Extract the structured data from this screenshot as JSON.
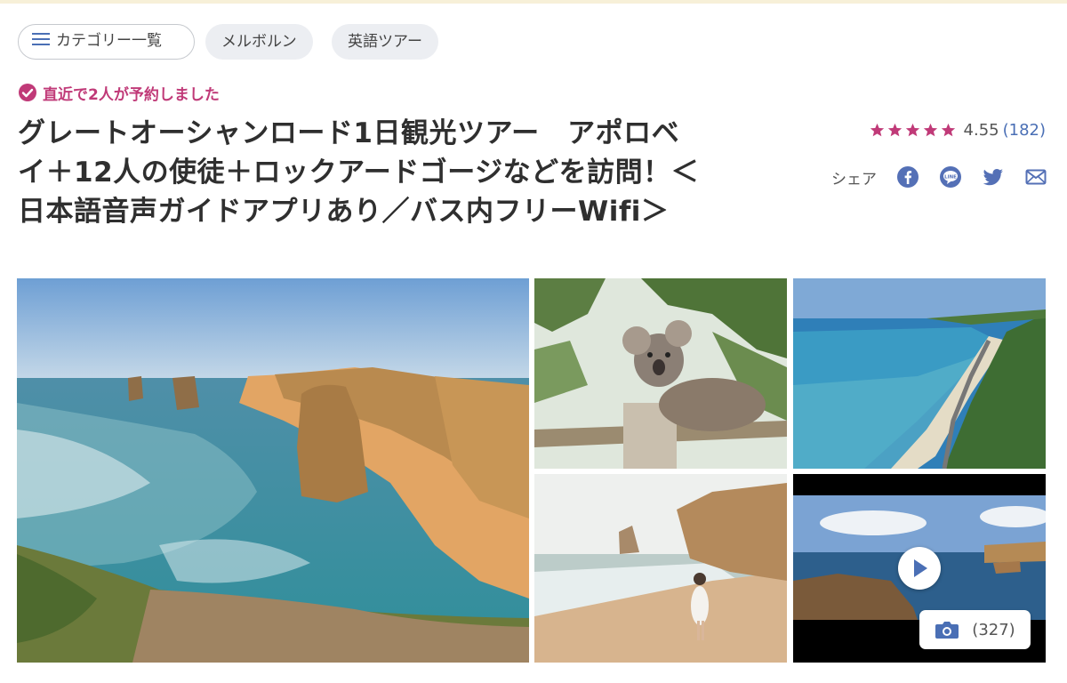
{
  "chips": {
    "category_menu": "カテゴリー一覧",
    "tag_1": "メルボルン",
    "tag_2": "英語ツアー"
  },
  "booking_notice": "直近で2人が予約しました",
  "tour_title": "グレートオーシャンロード1日観光ツアー　アポロベイ＋12人の使徒＋ロックアードゴージなどを訪問！＜日本語音声ガイドアプリあり／バス内フリーWifi＞",
  "rating": {
    "stars": 5,
    "score": "4.55",
    "count": "(182)"
  },
  "share": {
    "label": "シェア",
    "icons": [
      "facebook-icon",
      "line-icon",
      "twitter-icon",
      "mail-icon"
    ]
  },
  "gallery": {
    "photo_count": "(327)",
    "photos": [
      "twelve-apostles-coast",
      "koala-in-tree",
      "aerial-coastline",
      "woman-on-beach",
      "video-cliffs"
    ]
  },
  "colors": {
    "accent_pink": "#c03a78",
    "link_blue": "#4a6fb5",
    "icon_blue": "#5470b6"
  }
}
